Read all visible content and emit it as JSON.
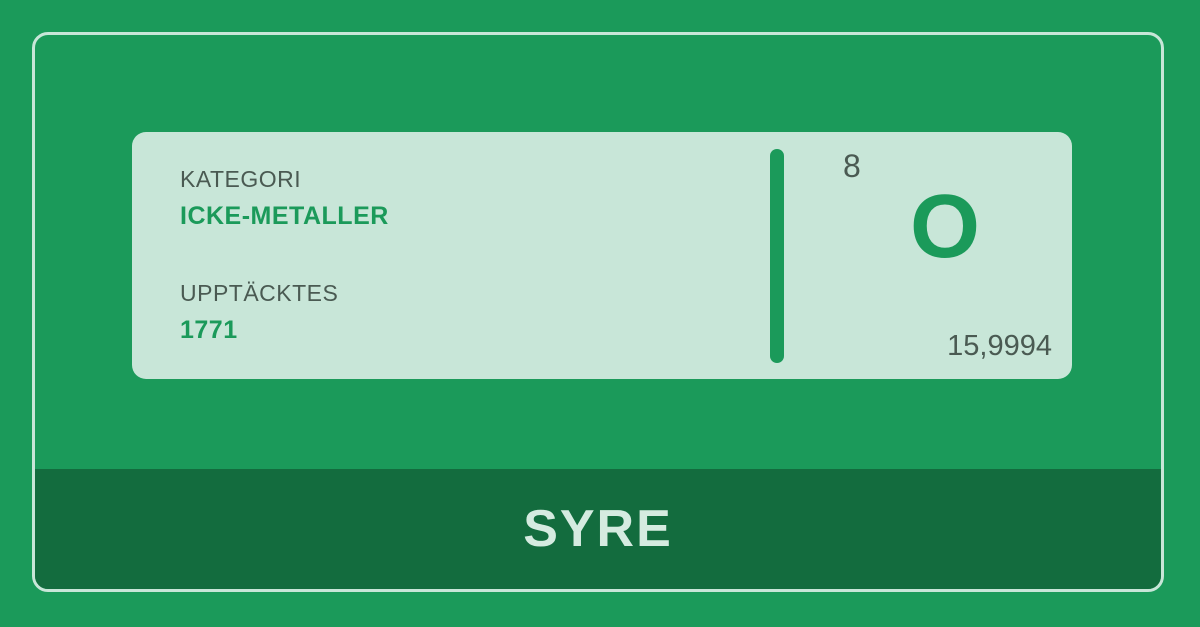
{
  "card": {
    "category_label": "KATEGORI",
    "category_value": "ICKE-METALLER",
    "discovered_label": "UPPTÄCKTES",
    "discovered_value": "1771",
    "atomic_number": "8",
    "symbol": "O",
    "atomic_weight": "15,9994"
  },
  "element_name": "SYRE",
  "colors": {
    "background": "#1b9a5a",
    "card": "#c8e6d8",
    "name_bar": "#136c3e",
    "accent": "#1b9a5a"
  }
}
